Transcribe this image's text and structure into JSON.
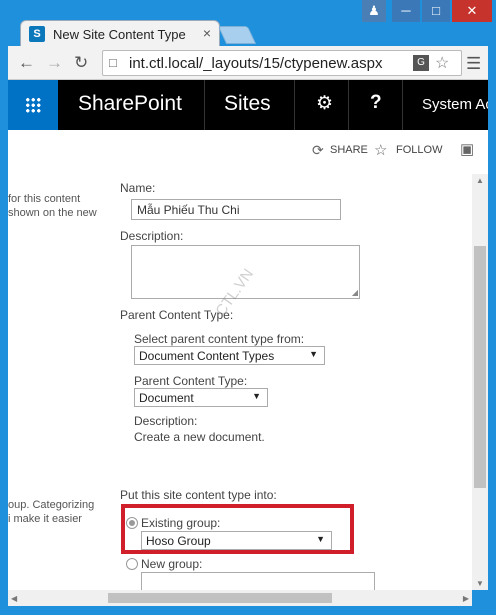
{
  "browser": {
    "tab_title": "New Site Content Type",
    "tab_close": "×",
    "favicon_letter": "S",
    "url": "int.ctl.local/_layouts/15/ctypenew.aspx"
  },
  "suitebar": {
    "brand": "SharePoint",
    "sites": "Sites",
    "user_label": "System Ac"
  },
  "actions": {
    "share": "SHARE",
    "follow": "FOLLOW"
  },
  "form": {
    "left_desc_1_line1": "for this content",
    "left_desc_1_line2": "shown on the new",
    "name_label": "Name:",
    "name_value": "Mẫu Phiếu Thu Chi",
    "description_label": "Description:",
    "parent_section_label": "Parent Content Type:",
    "select_parent_from_label": "Select parent content type from:",
    "parent_group_value": "Document Content Types",
    "parent_type_label": "Parent Content Type:",
    "parent_type_value": "Document",
    "parent_desc_label": "Description:",
    "parent_desc_value": "Create a new document.",
    "left_desc_2_line1": "oup. Categorizing",
    "left_desc_2_line2": "i make it easier",
    "group_section_label": "Put this site content type into:",
    "existing_group_label": "Existing group:",
    "existing_group_value": "Hoso Group",
    "new_group_label": "New group:"
  },
  "watermark": "CTL.VN",
  "icons": {
    "user": "user-icon",
    "minimize": "minimize-icon",
    "maximize": "maximize-icon",
    "close": "close-icon",
    "back": "back-arrow-icon",
    "forward": "forward-arrow-icon",
    "reload": "reload-icon",
    "page": "page-icon",
    "translate": "translate-icon",
    "star": "star-icon",
    "menu": "menu-icon",
    "waffle": "app-launcher-icon",
    "gear": "gear-icon",
    "help": "help-icon",
    "share": "share-icon",
    "follow": "follow-star-icon",
    "focus": "focus-mode-icon"
  }
}
